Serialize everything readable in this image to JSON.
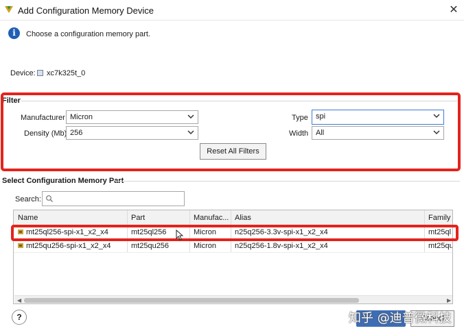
{
  "window": {
    "title": "Add Configuration Memory Device",
    "close_glyph": "✕"
  },
  "header": {
    "info_glyph": "i",
    "text": "Choose a configuration memory part."
  },
  "device": {
    "label": "Device:",
    "value": "xc7k325t_0"
  },
  "filter": {
    "title": "Filter",
    "manufacturer": {
      "label": "Manufacturer",
      "value": "Micron"
    },
    "density": {
      "label": "Density (Mb)",
      "value": "256"
    },
    "type": {
      "label": "Type",
      "value": "spi"
    },
    "width": {
      "label": "Width",
      "value": "All"
    },
    "reset_label": "Reset All Filters"
  },
  "select_part": {
    "title": "Select Configuration Memory Part",
    "search_label": "Search:",
    "search_value": "",
    "columns": [
      "Name",
      "Part",
      "Manufac...",
      "Alias",
      "Family"
    ],
    "rows": [
      {
        "name": "mt25ql256-spi-x1_x2_x4",
        "part": "mt25ql256",
        "manufacturer": "Micron",
        "alias": "n25q256-3.3v-spi-x1_x2_x4",
        "family": "mt25ql"
      },
      {
        "name": "mt25qu256-spi-x1_x2_x4",
        "part": "mt25qu256",
        "manufacturer": "Micron",
        "alias": "n25q256-1.8v-spi-x1_x2_x4",
        "family": "mt25qu"
      }
    ]
  },
  "footer": {
    "help_label": "?",
    "cancel_label": "Cancel"
  },
  "watermark": "知乎 @迪普微科技",
  "colors": {
    "highlight_red": "#e3231c",
    "ok_blue": "#3e6db5",
    "info_blue": "#1f5fb4"
  }
}
